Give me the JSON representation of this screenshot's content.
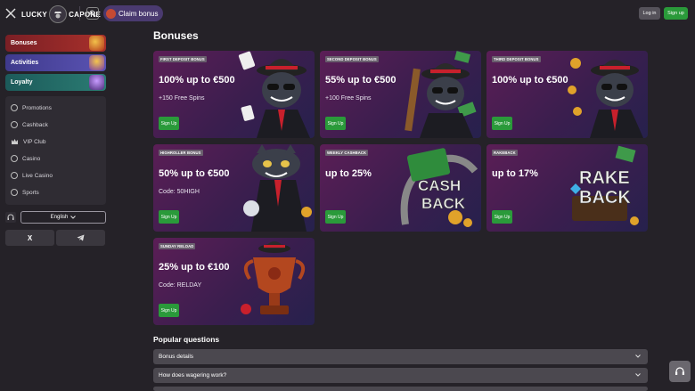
{
  "header": {
    "logo_left": "LUCKY",
    "logo_right": "CAPONE",
    "claim_label": "Claim bonus",
    "login_label": "Log in",
    "signup_label": "Sign up"
  },
  "sidebar": {
    "cards": [
      {
        "label": "Bonuses",
        "color": "#a8302b"
      },
      {
        "label": "Activities",
        "color": "#5a53b3"
      },
      {
        "label": "Loyalty",
        "color": "#2b7c73"
      }
    ],
    "menu": [
      {
        "label": "Promotions",
        "icon": "promotions-icon"
      },
      {
        "label": "Cashback",
        "icon": "cashback-icon"
      },
      {
        "label": "VIP Club",
        "icon": "crown-icon"
      },
      {
        "label": "Casino",
        "icon": "casino-icon"
      },
      {
        "label": "Live Casino",
        "icon": "live-casino-icon"
      },
      {
        "label": "Sports",
        "icon": "sports-icon"
      }
    ],
    "language": "English",
    "socials": [
      "X",
      "telegram-icon"
    ]
  },
  "main": {
    "title": "Bonuses",
    "cards": [
      {
        "tag": "FIRST DEPOSIT BONUS",
        "headline": "100% up to €500",
        "sub": "+150 Free Spins",
        "button": "Sign Up"
      },
      {
        "tag": "SECOND DEPOSIT BONUS",
        "headline": "55% up to €500",
        "sub": "+100 Free Spins",
        "button": "Sign Up"
      },
      {
        "tag": "THIRD DEPOSIT BONUS",
        "headline": "100% up to €500",
        "sub": "",
        "button": "Sign Up"
      },
      {
        "tag": "HIGHROLLER BONUS",
        "headline": "50% up to €500",
        "sub": "Code: 50HIGH",
        "button": "Sign Up"
      },
      {
        "tag": "WEEKLY CASHBACK",
        "headline": "up to 25%",
        "sub": "",
        "button": "Sign Up",
        "art_text": [
          "CASH",
          "BACK"
        ]
      },
      {
        "tag": "RAKEBACK",
        "headline": "up to 17%",
        "sub": "",
        "button": "Sign Up",
        "art_text": [
          "RAKE",
          "BACK"
        ]
      },
      {
        "tag": "SUNDAY RELOAD",
        "headline": "25% up to €100",
        "sub": "Code: RELDAY",
        "button": "Sign Up"
      }
    ],
    "faq_title": "Popular questions",
    "faq": [
      "Bonus details",
      "How does wagering work?"
    ]
  },
  "colors": {
    "accent_green": "#2a9a3a",
    "background": "#252228",
    "claim_purple": "#4a3a70"
  }
}
